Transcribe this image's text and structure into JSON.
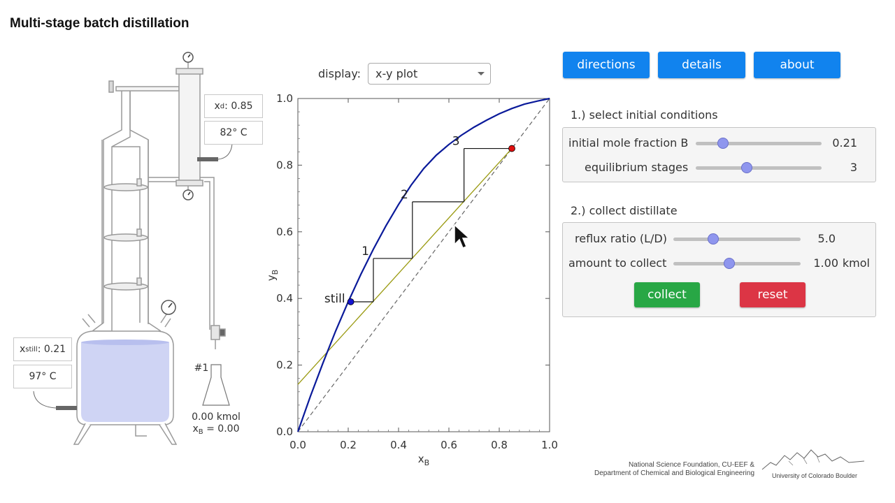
{
  "title": "Multi-stage batch distillation",
  "apparatus": {
    "xd_label": "x",
    "xd_sub": "d",
    "xd_value": ": 0.85",
    "condenser_temp": "82° C",
    "xstill_label": "x",
    "xstill_sub": "still",
    "xstill_value": ": 0.21",
    "still_temp": "97° C",
    "flask_number": "#1",
    "flask_amount": "0.00 kmol",
    "flask_x_label": "x",
    "flask_x_sub": "B",
    "flask_x_value": " = 0.00",
    "liquid_color": "#cfd4f4"
  },
  "display": {
    "label": "display:",
    "selected": "x-y plot"
  },
  "buttons": {
    "directions": "directions",
    "details": "details",
    "about": "about",
    "collect": "collect",
    "reset": "reset"
  },
  "section1": {
    "title": "1.) select initial conditions",
    "initial_mole_fraction": {
      "label": "initial mole fraction B",
      "value": "0.21",
      "fraction": 0.21
    },
    "equilibrium_stages": {
      "label": "equilibrium stages",
      "value": "3",
      "fraction": 0.4
    }
  },
  "section2": {
    "title": "2.) collect distillate",
    "reflux_ratio": {
      "label": "reflux ratio (L/D)",
      "value": "5.0",
      "fraction": 0.31
    },
    "amount_to_collect": {
      "label": "amount to collect",
      "value": "1.00",
      "unit": "kmol",
      "fraction": 0.45
    }
  },
  "credits": {
    "line1": "National Science Foundation, CU-EEF &",
    "line2": "Department of Chemical and Biological Engineering",
    "university": "University of Colorado Boulder"
  },
  "colors": {
    "button_blue": "#1183ee",
    "button_green": "#28a745",
    "button_red": "#dc3545",
    "equilibrium_curve": "#0a1a9a",
    "operating_line": "#9a9a10",
    "still_point": "#1414d0",
    "distillate_point": "#e01010"
  },
  "chart_data": {
    "type": "line",
    "xlabel": "x",
    "xlabel_sub": "B",
    "ylabel": "y",
    "ylabel_sub": "B",
    "xlim": [
      0,
      1
    ],
    "ylim": [
      0,
      1
    ],
    "xticks": [
      "0.0",
      "0.2",
      "0.4",
      "0.6",
      "0.8",
      "1.0"
    ],
    "yticks": [
      "0.0",
      "0.2",
      "0.4",
      "0.6",
      "0.8",
      "1.0"
    ],
    "equilibrium_curve": {
      "x": [
        0,
        0.05,
        0.1,
        0.15,
        0.2,
        0.25,
        0.3,
        0.35,
        0.4,
        0.45,
        0.5,
        0.55,
        0.6,
        0.65,
        0.7,
        0.75,
        0.8,
        0.85,
        0.9,
        0.95,
        1.0
      ],
      "y": [
        0,
        0.107,
        0.207,
        0.302,
        0.39,
        0.472,
        0.548,
        0.618,
        0.682,
        0.74,
        0.79,
        0.83,
        0.862,
        0.89,
        0.914,
        0.935,
        0.954,
        0.97,
        0.983,
        0.992,
        1.0
      ]
    },
    "diagonal": {
      "x": [
        0,
        1
      ],
      "y": [
        0,
        1
      ]
    },
    "operating_line": {
      "x": [
        0,
        0.85
      ],
      "y": [
        0.142,
        0.85
      ]
    },
    "steps": [
      {
        "x": [
          0.21,
          0.3
        ],
        "y": [
          0.39,
          0.39
        ]
      },
      {
        "x": [
          0.3,
          0.3
        ],
        "y": [
          0.39,
          0.52
        ]
      },
      {
        "x": [
          0.3,
          0.455
        ],
        "y": [
          0.52,
          0.52
        ]
      },
      {
        "x": [
          0.455,
          0.455
        ],
        "y": [
          0.52,
          0.69
        ]
      },
      {
        "x": [
          0.455,
          0.66
        ],
        "y": [
          0.69,
          0.69
        ]
      },
      {
        "x": [
          0.66,
          0.66
        ],
        "y": [
          0.69,
          0.85
        ]
      },
      {
        "x": [
          0.66,
          0.85
        ],
        "y": [
          0.85,
          0.85
        ]
      }
    ],
    "stage_labels": [
      {
        "text": "1",
        "x": 0.3,
        "y": 0.52
      },
      {
        "text": "2",
        "x": 0.455,
        "y": 0.69
      },
      {
        "text": "3",
        "x": 0.66,
        "y": 0.85
      }
    ],
    "still_point": {
      "label": "still",
      "x": 0.21,
      "y": 0.39
    },
    "distillate_point": {
      "x": 0.85,
      "y": 0.85
    }
  }
}
